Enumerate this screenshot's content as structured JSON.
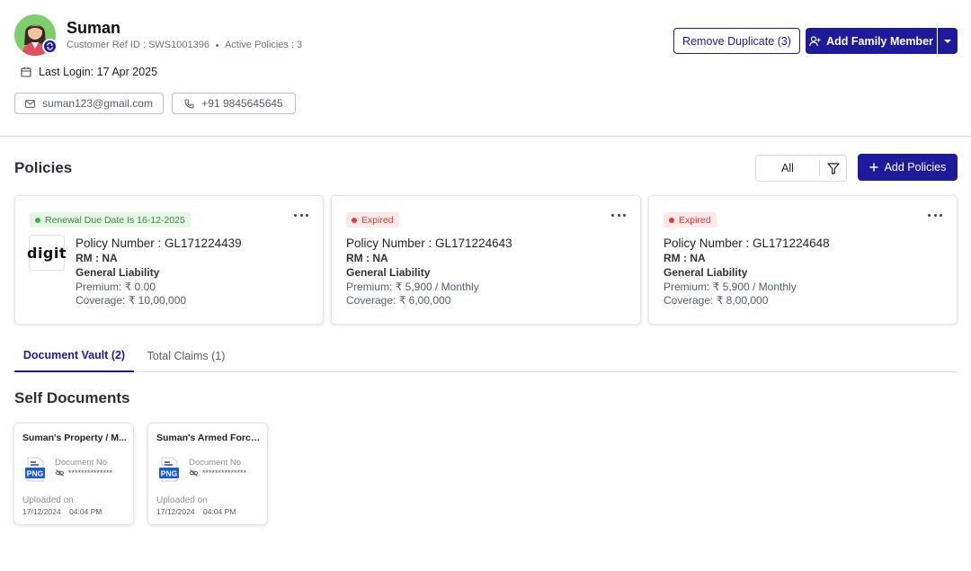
{
  "profile": {
    "name": "Suman",
    "customer_ref": "Customer Ref ID : SWS1001396",
    "active_policies": "Active Policies : 3",
    "last_login": "Last Login: 17 Apr 2025",
    "email": "suman123@gmail.com",
    "phone": "+91 9845645645",
    "avatar_icon": "user-avatar",
    "badge_icon": "sync-icon"
  },
  "actions": {
    "remove_duplicate": "Remove Duplicate (3)",
    "add_family_member": "Add Family Member"
  },
  "policies": {
    "title": "Policies",
    "filter_value": "All",
    "add_button": "Add Policies",
    "cards": [
      {
        "status": "Renewal Due Date Is 16-12-2025",
        "status_color": "#3ab34a",
        "logo_text": "digit",
        "number": "Policy Number : GL171224439",
        "rm": "RM : NA",
        "type": "General Liability",
        "premium": "Premium: ₹ 0.00",
        "coverage": "Coverage: ₹ 10,00,000"
      },
      {
        "status": "Expired",
        "status_color": "#e53935",
        "number": "Policy Number : GL171224643",
        "rm": "RM : NA",
        "type": "General Liability",
        "premium": "Premium: ₹ 5,900 / Monthly",
        "coverage": "Coverage: ₹ 6,00,000"
      },
      {
        "status": "Expired",
        "status_color": "#e53935",
        "number": "Policy Number : GL171224648",
        "rm": "RM : NA",
        "type": "General Liability",
        "premium": "Premium: ₹ 5,900 / Monthly",
        "coverage": "Coverage: ₹ 8,00,000"
      }
    ]
  },
  "tabs": [
    {
      "label": "Document Vault (2)",
      "active": true
    },
    {
      "label": "Total Claims (1)",
      "active": false
    }
  ],
  "self_documents": {
    "title": "Self Documents",
    "items": [
      {
        "title": "Suman's Property / M...",
        "file_type": "PNG",
        "doc_no_label": "Document No",
        "doc_no_value": "**************",
        "uploaded_label": "Uploaded on",
        "uploaded_date": "17/12/2024",
        "uploaded_time": "04:04 PM"
      },
      {
        "title": "Suman's Armed Force ...",
        "file_type": "PNG",
        "doc_no_label": "Document No",
        "doc_no_value": "**************",
        "uploaded_label": "Uploaded on",
        "uploaded_date": "17/12/2024",
        "uploaded_time": "04:04 PM"
      }
    ]
  },
  "colors": {
    "brand": "#1d1a9c",
    "success": "#3ab34a",
    "danger": "#e53935"
  }
}
